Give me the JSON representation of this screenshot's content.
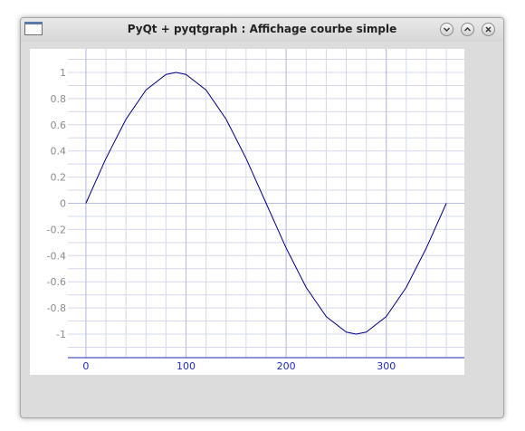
{
  "window": {
    "title": "PyQt + pyqtgraph : Affichage courbe simple",
    "buttons": [
      "minimize",
      "maximize",
      "close"
    ]
  },
  "colors": {
    "curve": "#000080",
    "x_axis": "#1f2ab3",
    "y_tick_text": "#8c8c8c",
    "grid": "#d5d8ee",
    "zero_lines": "#b8bce0"
  },
  "chart_data": {
    "type": "line",
    "title": "",
    "xlabel": "",
    "ylabel": "",
    "xlim": [
      -18,
      378
    ],
    "ylim": [
      -1.18,
      1.18
    ],
    "xticks": [
      0,
      100,
      200,
      300
    ],
    "xtick_labels": [
      "0",
      "100",
      "200",
      "300"
    ],
    "yticks": [
      1,
      0.8,
      0.6,
      0.4,
      0.2,
      0,
      -0.2,
      -0.4,
      -0.6,
      -0.8,
      -1
    ],
    "ytick_labels": [
      "1",
      "0.8",
      "0.6",
      "0.4",
      "0.2",
      "0",
      "-0.2",
      "-0.4",
      "-0.6",
      "-0.8",
      "-1"
    ],
    "grid": true,
    "series": [
      {
        "x": [
          0,
          20,
          40,
          60,
          80,
          90,
          100,
          120,
          140,
          160,
          180,
          200,
          220,
          240,
          260,
          270,
          280,
          300,
          320,
          340,
          360
        ],
        "y": [
          0,
          0.342,
          0.643,
          0.866,
          0.985,
          1,
          0.985,
          0.866,
          0.643,
          0.342,
          0,
          -0.342,
          -0.643,
          -0.866,
          -0.985,
          -1,
          -0.985,
          -0.866,
          -0.643,
          -0.342,
          0
        ]
      }
    ]
  }
}
